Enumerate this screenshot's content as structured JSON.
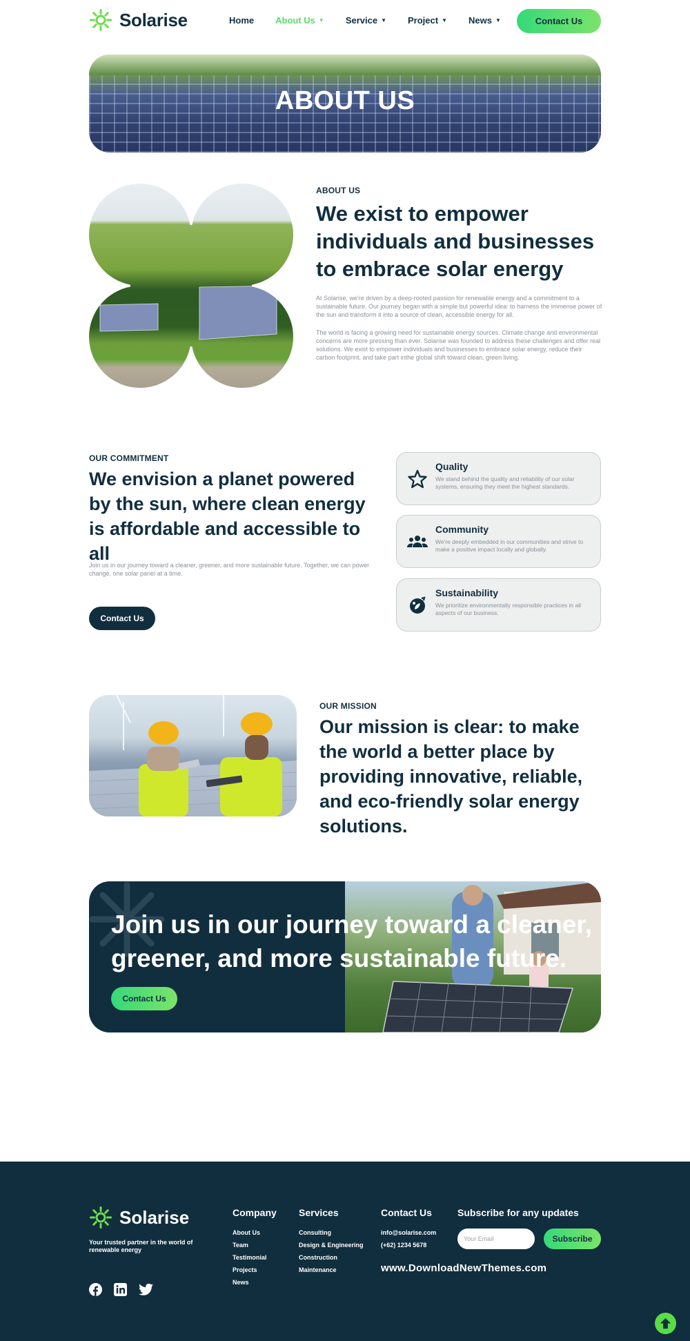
{
  "brand": {
    "name": "Solarise",
    "accent": "#5bdc67",
    "dark": "#112e3e"
  },
  "nav": {
    "items": [
      {
        "label": "Home",
        "active": false,
        "dropdown": false
      },
      {
        "label": "About Us",
        "active": true,
        "dropdown": true
      },
      {
        "label": "Service",
        "active": false,
        "dropdown": true
      },
      {
        "label": "Project",
        "active": false,
        "dropdown": true
      },
      {
        "label": "News",
        "active": false,
        "dropdown": true
      }
    ],
    "cta_label": "Contact Us"
  },
  "hero": {
    "title": "ABOUT US"
  },
  "about": {
    "eyebrow": "ABOUT US",
    "heading": "We exist to empower individuals and businesses to embrace solar energy",
    "para1": "At Solarise, we're driven by a deep-rooted passion for renewable energy and a commitment to a sustainable future. Our journey began with a simple but powerful idea: to harness the immense power of the sun and transform it into a source of clean, accessible energy for all.",
    "para2": "The world is facing a growing need for sustainable energy sources. Climate change and environmental concerns are more pressing than ever. Solarise was founded to address these challenges and offer real solutions. We exist to empower individuals and businesses to embrace solar energy, reduce their carbon footprint, and take part inthe global shift toward clean, green living."
  },
  "commitment": {
    "eyebrow": "OUR COMMITMENT",
    "heading": "We envision a planet powered by the sun, where clean energy is affordable and accessible to all",
    "text": "Join us in our journey toward a cleaner, greener, and more sustainable future. Together, we can power change, one solar panel at a time.",
    "cta_label": "Contact Us",
    "cards": [
      {
        "title": "Quality",
        "desc": "We stand behind the quality and reliability of our solar systems, ensuring they meet the highest standards.",
        "icon": "star-icon"
      },
      {
        "title": "Community",
        "desc": "We're deeply embedded in our communities and strive to make a positive impact locally and globally.",
        "icon": "community-icon"
      },
      {
        "title": "Sustainability",
        "desc": "We prioritize environmentally responsible practices in all aspects of our business.",
        "icon": "sustainability-icon"
      }
    ]
  },
  "mission": {
    "eyebrow": "OUR MISSION",
    "heading": "Our mission is clear: to make the world a better place by providing innovative, reliable, and eco-friendly solar energy solutions."
  },
  "join": {
    "title": "Join us in our journey toward a cleaner, greener, and more sustainable future.",
    "cta_label": "Contact Us"
  },
  "footer": {
    "brand": "Solarise",
    "tagline": "Your trusted partner in the world of renewable energy",
    "social": [
      "facebook-icon",
      "linkedin-icon",
      "twitter-icon"
    ],
    "company": {
      "title": "Company",
      "links": [
        "About Us",
        "Team",
        "Testimonial",
        "Projects",
        "News"
      ]
    },
    "services": {
      "title": "Services",
      "links": [
        "Consulting",
        "Design & Engineering",
        "Construction",
        "Maintenance"
      ]
    },
    "contact": {
      "title": "Contact Us",
      "email": "info@solarise.com",
      "phone": "(+62) 1234 5678"
    },
    "subscribe": {
      "title": "Subscribe for any updates",
      "placeholder": "Your Email",
      "button": "Subscribe"
    },
    "watermark": "www.DownloadNewThemes.com"
  }
}
